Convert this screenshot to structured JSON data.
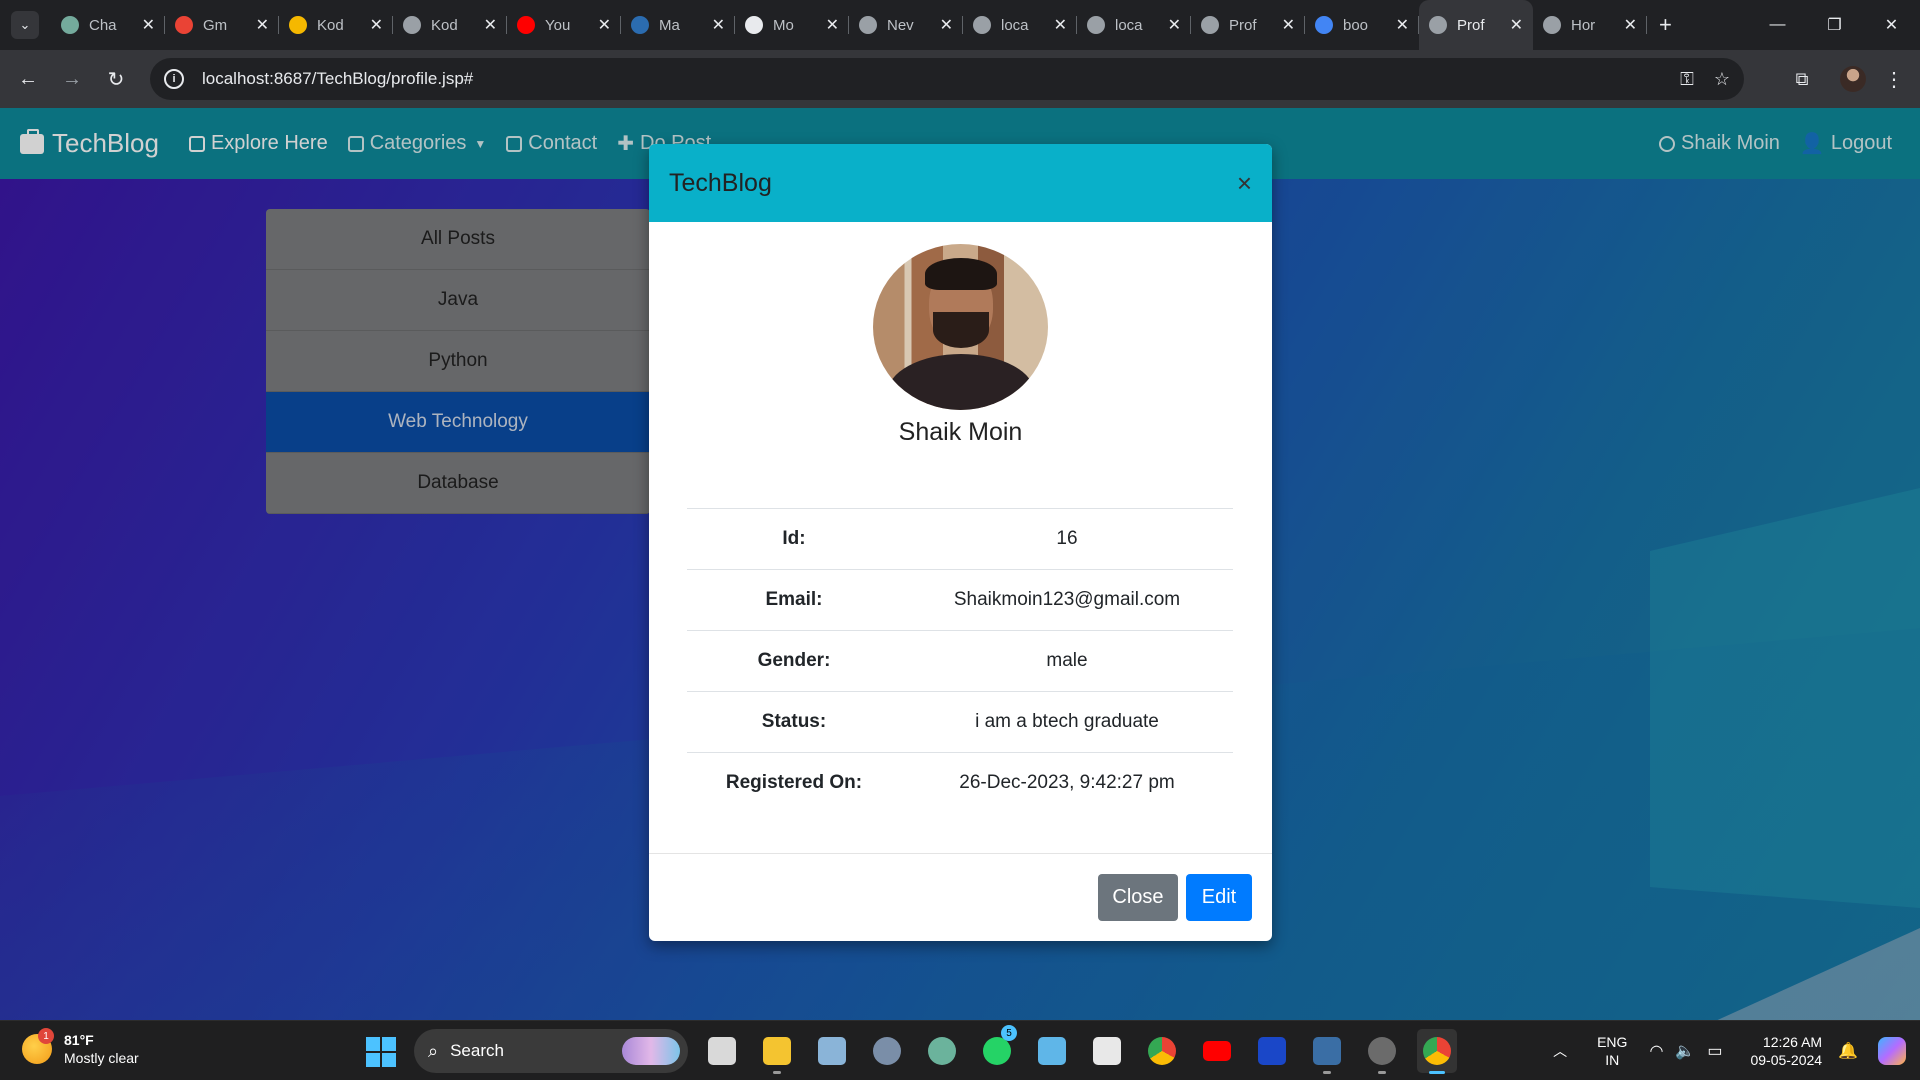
{
  "browser": {
    "tabs": [
      {
        "title": "Cha",
        "favicon": "chatgpt-icon",
        "color": "#74aa9c"
      },
      {
        "title": "Gm",
        "favicon": "gmail-icon",
        "color": "#ea4335"
      },
      {
        "title": "Kod",
        "favicon": "k-icon",
        "color": "#f5b800"
      },
      {
        "title": "Kod",
        "favicon": "globe-icon",
        "color": "#9aa0a6"
      },
      {
        "title": "You",
        "favicon": "youtube-icon",
        "color": "#ff0000"
      },
      {
        "title": "Ma",
        "favicon": "mvn-icon",
        "color": "#2b6cb0"
      },
      {
        "title": "Mo",
        "favicon": "github-icon",
        "color": "#e8eaed"
      },
      {
        "title": "Nev",
        "favicon": "globe-icon",
        "color": "#9aa0a6"
      },
      {
        "title": "loca",
        "favicon": "globe-icon",
        "color": "#9aa0a6"
      },
      {
        "title": "loca",
        "favicon": "globe-icon",
        "color": "#9aa0a6"
      },
      {
        "title": "Prof",
        "favicon": "globe-icon",
        "color": "#9aa0a6"
      },
      {
        "title": "boo",
        "favicon": "google-icon",
        "color": "#4285f4"
      },
      {
        "title": "Prof",
        "favicon": "globe-icon",
        "color": "#9aa0a6",
        "active": true
      },
      {
        "title": "Hor",
        "favicon": "globe-icon",
        "color": "#9aa0a6"
      }
    ],
    "url": "localhost:8687/TechBlog/profile.jsp#"
  },
  "site": {
    "brand": "TechBlog",
    "nav": {
      "explore": "Explore Here",
      "categories": "Categories",
      "contact": "Contact",
      "do_post": "Do Post",
      "user": "Shaik Moin",
      "logout": "Logout"
    },
    "categories": [
      "All Posts",
      "Java",
      "Python",
      "Web Technology",
      "Database"
    ],
    "active_category": "Web Technology"
  },
  "modal": {
    "title": "TechBlog",
    "close_symbol": "×",
    "name": "Shaik Moin",
    "rows": [
      {
        "label": "Id:",
        "value": "16"
      },
      {
        "label": "Email:",
        "value": "Shaikmoin123@gmail.com"
      },
      {
        "label": "Gender:",
        "value": "male"
      },
      {
        "label": "Status:",
        "value": "i am a btech graduate"
      },
      {
        "label": "Registered On:",
        "value": "26-Dec-2023, 9:42:27 pm"
      }
    ],
    "close_label": "Close",
    "edit_label": "Edit"
  },
  "taskbar": {
    "weather_temp": "81°F",
    "weather_desc": "Mostly clear",
    "weather_badge": "1",
    "search_label": "Search",
    "whatsapp_badge": "5",
    "lang_line1": "ENG",
    "lang_line2": "IN",
    "time": "12:26 AM",
    "date": "09-05-2024"
  }
}
